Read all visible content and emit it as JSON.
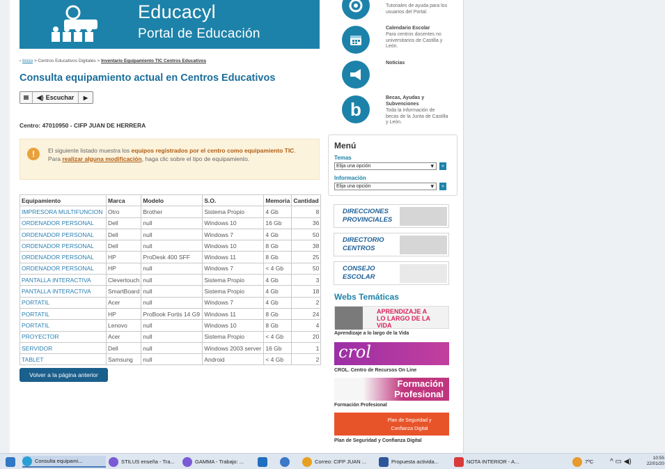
{
  "banner": {
    "title": "Educacyl",
    "subtitle": "Portal de Educación"
  },
  "breadcrumb": {
    "home": "Inicio",
    "middle": " > Centros Educativos Digitales > ",
    "current": "Inventario Equipamiento TIC Centros Educativos"
  },
  "page_title": "Consulta equipamiento actual en Centros Educativos",
  "toolbar": {
    "listen_label": "Escuchar"
  },
  "centro": "Centro: 47010950 - CIFP JUAN DE HERRERA",
  "notice": {
    "p1": "El siguiente listado muestra los ",
    "p1_bold": "equipos registrados por el centro como equipamiento TIC",
    "p1_end": ".",
    "p2": "Para ",
    "p2_link": "realizar alguna modificación",
    "p2_end": ", haga clic sobre el tipo de equipamiento."
  },
  "table": {
    "headers": [
      "Equipamiento",
      "Marca",
      "Modelo",
      "S.O.",
      "Memoria",
      "Cantidad"
    ],
    "rows": [
      [
        "IMPRESORA MULTIFUNCION",
        "Otro",
        "Brother",
        "Sistema Propio",
        "4 Gb",
        "8"
      ],
      [
        "ORDENADOR PERSONAL",
        "Dell",
        "null",
        "Windows 10",
        "16 Gb",
        "36"
      ],
      [
        "ORDENADOR PERSONAL",
        "Dell",
        "null",
        "Windows 7",
        "4 Gb",
        "50"
      ],
      [
        "ORDENADOR PERSONAL",
        "Dell",
        "null",
        "Windows 10",
        "8 Gb",
        "38"
      ],
      [
        "ORDENADOR PERSONAL",
        "HP",
        "ProDesk 400 SFF",
        "Windows 11",
        "8 Gb",
        "25"
      ],
      [
        "ORDENADOR PERSONAL",
        "HP",
        "null",
        "Windows 7",
        "< 4 Gb",
        "50"
      ],
      [
        "PANTALLA INTERACTIVA",
        "Clevertouch",
        "null",
        "Sistema Propio",
        "4 Gb",
        "3"
      ],
      [
        "PANTALLA INTERACTIVA",
        "SmartBoard",
        "null",
        "Sistema Propio",
        "4 Gb",
        "18"
      ],
      [
        "PORTATIL",
        "Acer",
        "null",
        "Windows 7",
        "4 Gb",
        "2"
      ],
      [
        "PORTATIL",
        "HP",
        "ProBook Fortis 14 G9",
        "Windows 11",
        "8 Gb",
        "24"
      ],
      [
        "PORTATIL",
        "Lenovo",
        "null",
        "Windows 10",
        "8 Gb",
        "4"
      ],
      [
        "PROYECTOR",
        "Acer",
        "null",
        "Sistema Propio",
        "< 4 Gb",
        "20"
      ],
      [
        "SERVIDOR",
        "Dell",
        "null",
        "Windows 2003 server",
        "16 Gb",
        "1"
      ],
      [
        "TABLET",
        "Samsung",
        "null",
        "Android",
        "< 4 Gb",
        "2"
      ]
    ]
  },
  "back_button": "Volver a la página anterior",
  "side_links": [
    {
      "title": "",
      "desc": "Tutoriales de ayuda para los usuarios del Portal.",
      "icon": "life-ring-icon"
    },
    {
      "title": "Calendario Escolar",
      "desc": "Para centros docentes no universitarios de Castilla y León.",
      "icon": "calendar-icon"
    },
    {
      "title": "Noticias",
      "desc": "",
      "icon": "megaphone-icon"
    },
    {
      "title": "Becas, Ayudas y Subvenciones",
      "desc": "Toda la información de becas de la Junta de Castilla y León.",
      "icon": "becas-b-icon"
    }
  ],
  "menu": {
    "title": "Menú",
    "temas_label": "Temas",
    "temas_value": "Elija una opción",
    "info_label": "Información",
    "info_value": "Elija una opción",
    "go": "»"
  },
  "banners": [
    "DIRECCIONES PROVINCIALES",
    "DIRECTORIO CENTROS",
    "CONSEJO ESCOLAR"
  ],
  "webs": {
    "title": "Webs Temáticas",
    "items": [
      {
        "caption": "Aprendizaje a lo largo de la Vida",
        "text": "APRENDIZAJE A LO LARGO DE LA VIDA",
        "color": "#f2f2f2"
      },
      {
        "caption": "CROL. Centro de Recursos On Line",
        "text": "crol",
        "color": "#9b2fa6"
      },
      {
        "caption": "Formación Profesional",
        "text": "Formación Profesional",
        "color": "#c0367e"
      },
      {
        "caption": "Plan de Seguridad y Confianza Digital",
        "text": "Plan de Seguridad y Confianza Digital",
        "color": "#e8542a"
      }
    ]
  },
  "taskbar": {
    "items": [
      "Consulta equipami...",
      "STILUS enseña - Tra...",
      "GAMMA - Trabajo: ...",
      "",
      "",
      "Correo: CIFP JUAN ...",
      "Propuesta activida...",
      "NOTA INTERIOR - A..."
    ],
    "temp": "7ºC",
    "time": "10:55",
    "date": "22/01/20"
  }
}
